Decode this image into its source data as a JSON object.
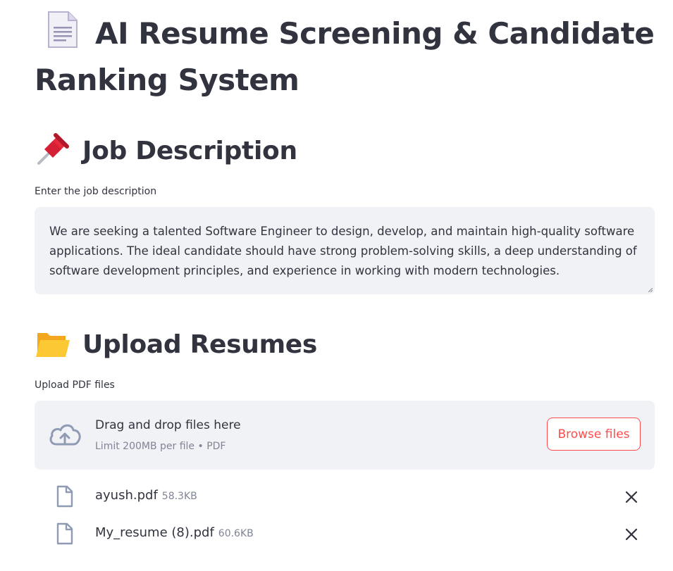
{
  "title": "AI Resume Screening & Candidate Ranking System",
  "title_icon": "page-facing-up-icon",
  "job_section": {
    "heading": "Job Description",
    "icon": "pushpin-icon",
    "input_label": "Enter the job description",
    "input_value": "We are seeking a talented Software Engineer to design, develop, and maintain high-quality software applications. The ideal candidate should have strong problem-solving skills, a deep understanding of software development principles, and experience in working with modern technologies."
  },
  "upload_section": {
    "heading": "Upload Resumes",
    "icon": "open-folder-icon",
    "input_label": "Upload PDF files",
    "dropzone_text": "Drag and drop files here",
    "dropzone_limit": "Limit 200MB per file • PDF",
    "browse_label": "Browse files",
    "files": [
      {
        "name": "ayush.pdf",
        "size": "58.3KB"
      },
      {
        "name": "My_resume (8).pdf",
        "size": "60.6KB"
      }
    ]
  },
  "colors": {
    "accent": "#ff4b4b",
    "text": "#31333f",
    "muted": "#808495",
    "input_bg": "#f0f2f6"
  }
}
